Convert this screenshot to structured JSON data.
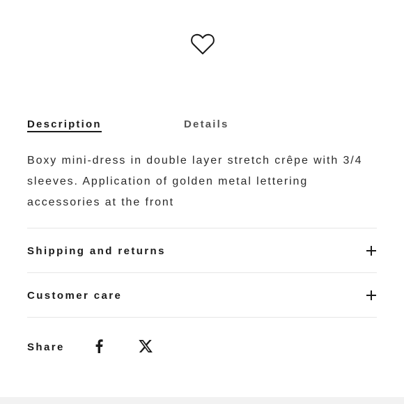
{
  "tabs": [
    {
      "label": "Description",
      "active": true
    },
    {
      "label": "Details",
      "active": false
    }
  ],
  "description": "Boxy mini-dress in double layer stretch crêpe with 3/4 sleeves. Application of golden metal lettering accessories at the front",
  "accordions": [
    {
      "label": "Shipping and returns",
      "icon": "plus-icon"
    },
    {
      "label": "Customer care",
      "icon": "plus-icon"
    }
  ],
  "share": {
    "label": "Share",
    "icons": [
      "facebook-icon",
      "x-icon"
    ]
  },
  "wishlist_icon": "heart-icon",
  "colors": {
    "text": "#1a1a1a",
    "muted": "#555555",
    "divider": "#e6e6e6"
  }
}
